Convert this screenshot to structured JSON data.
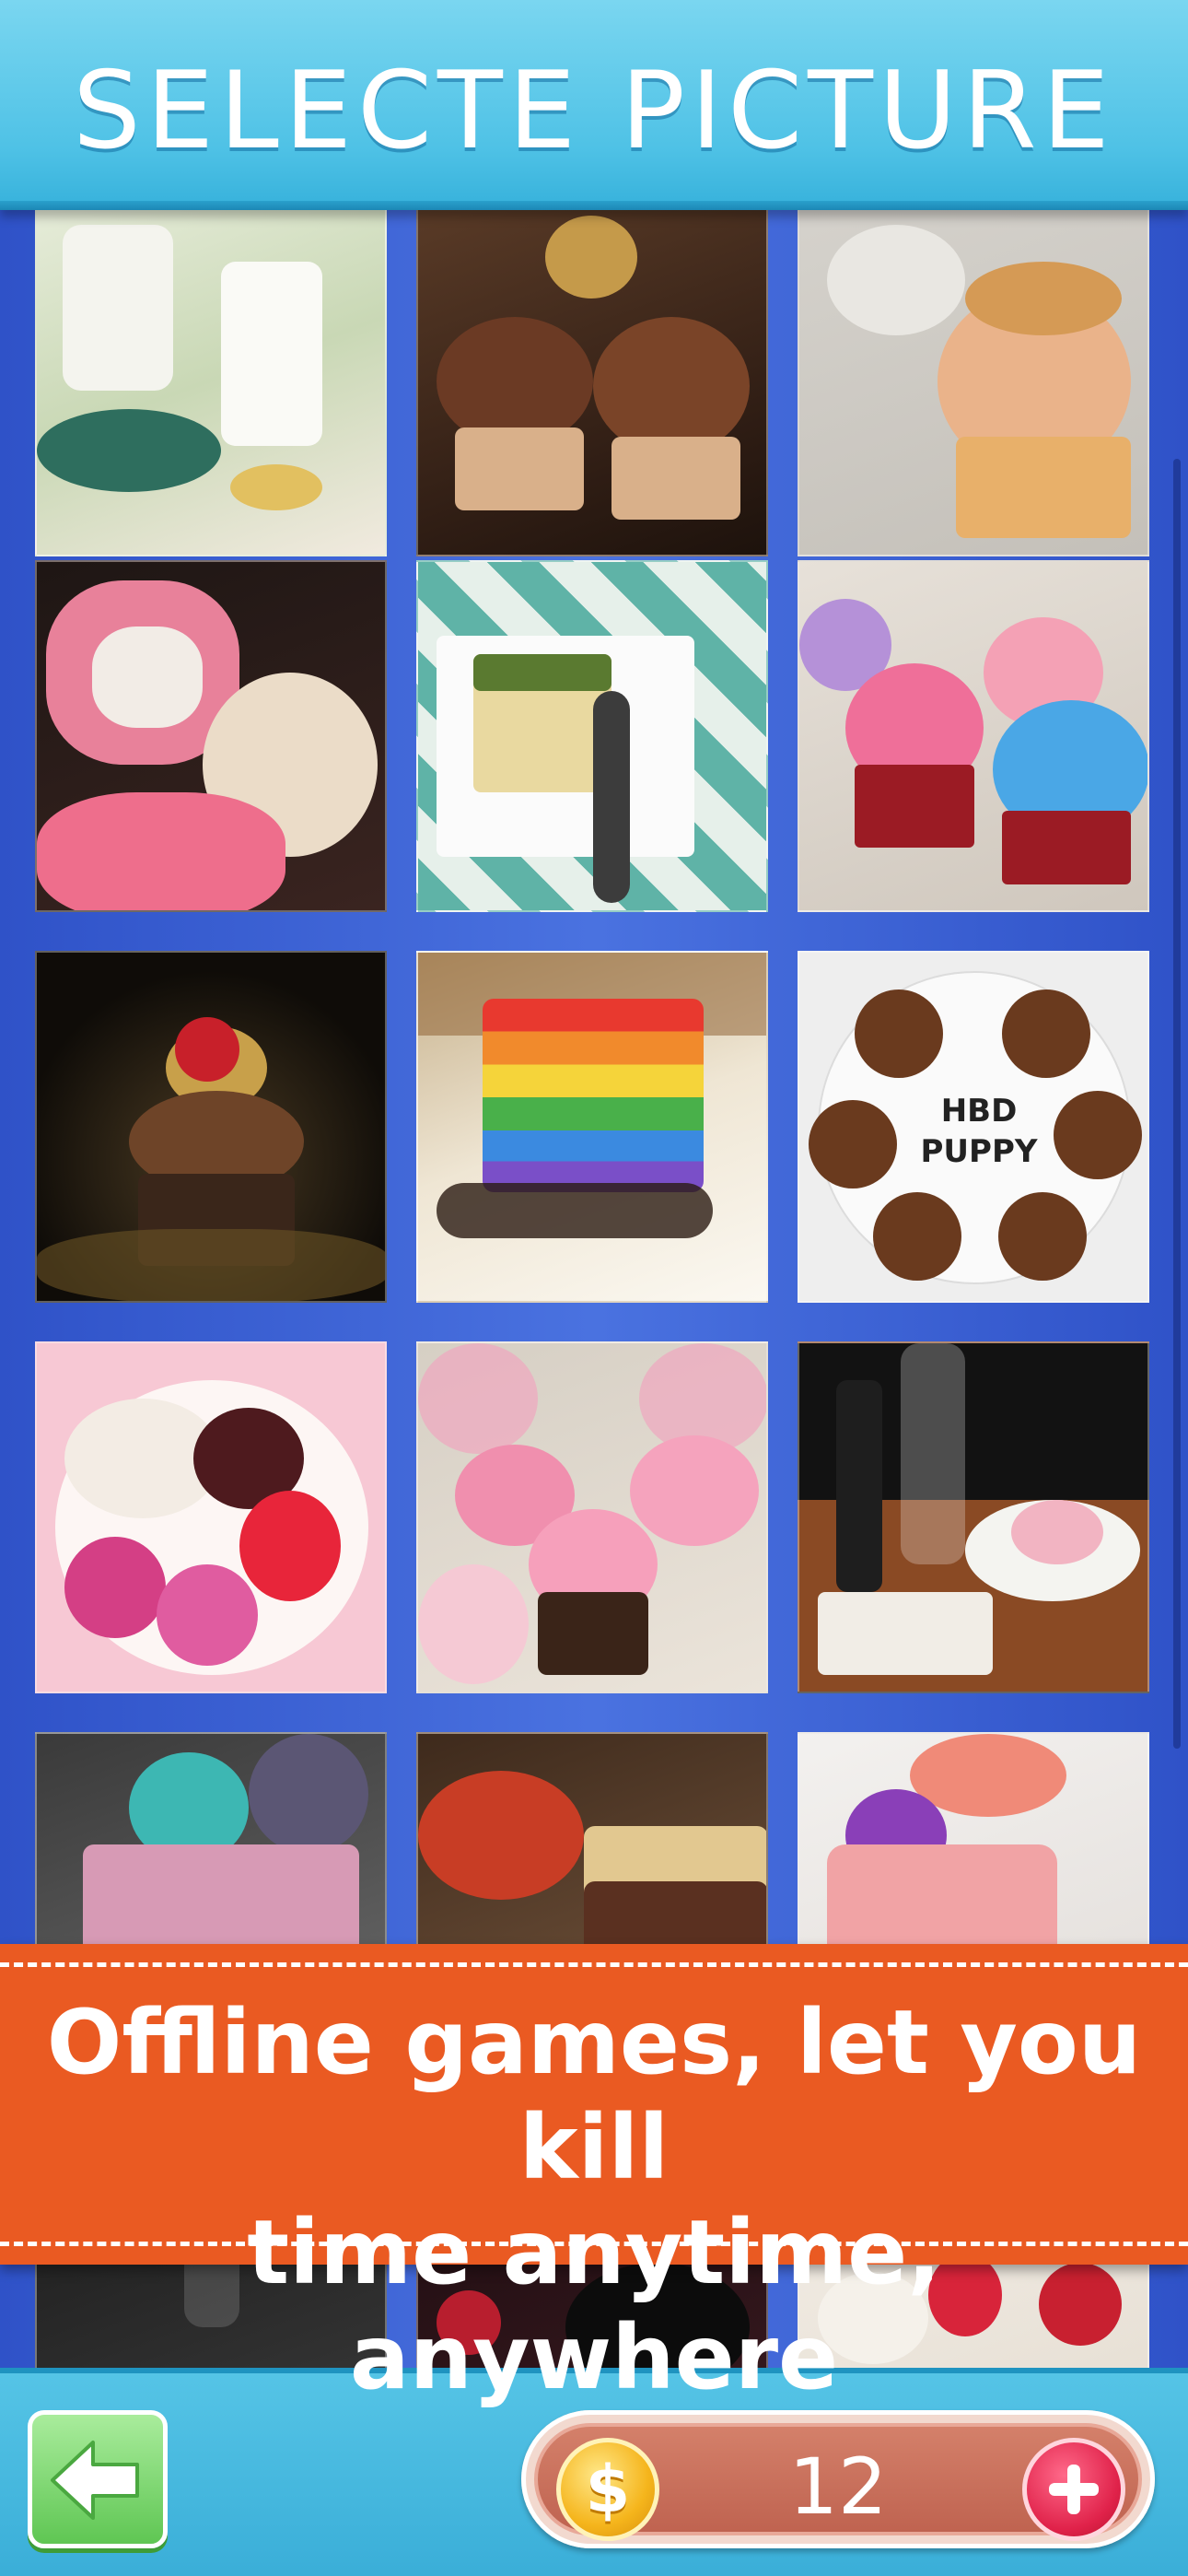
{
  "header": {
    "title": "SELECTE PICTURE"
  },
  "banner": {
    "line1": "Offline games, let you kill",
    "line2": "time anytime, anywhere"
  },
  "footer": {
    "back_icon": "back-arrow-icon",
    "coin_icon": "coin-icon",
    "coin_symbol": "$",
    "coin_count": "12",
    "plus_icon": "plus-icon"
  },
  "pictures": [
    {
      "name": "irish-coffee-mugs"
    },
    {
      "name": "christmas-cupcakes"
    },
    {
      "name": "face-cupcakes"
    },
    {
      "name": "heart-cookies"
    },
    {
      "name": "matcha-cake-slice"
    },
    {
      "name": "frosted-cupcakes"
    },
    {
      "name": "gold-cupcake"
    },
    {
      "name": "rainbow-cake-slice"
    },
    {
      "name": "puppy-cupcakes",
      "text": "HBD PUPPY"
    },
    {
      "name": "macaron-plate"
    },
    {
      "name": "pink-cupcakes"
    },
    {
      "name": "wine-and-dessert"
    },
    {
      "name": "teal-meringue-cake"
    },
    {
      "name": "tea-and-cake"
    },
    {
      "name": "pink-flower-cake"
    },
    {
      "name": "dark-glass-dessert"
    },
    {
      "name": "berry-dark-dessert"
    },
    {
      "name": "cream-strawberry-cake"
    }
  ]
}
